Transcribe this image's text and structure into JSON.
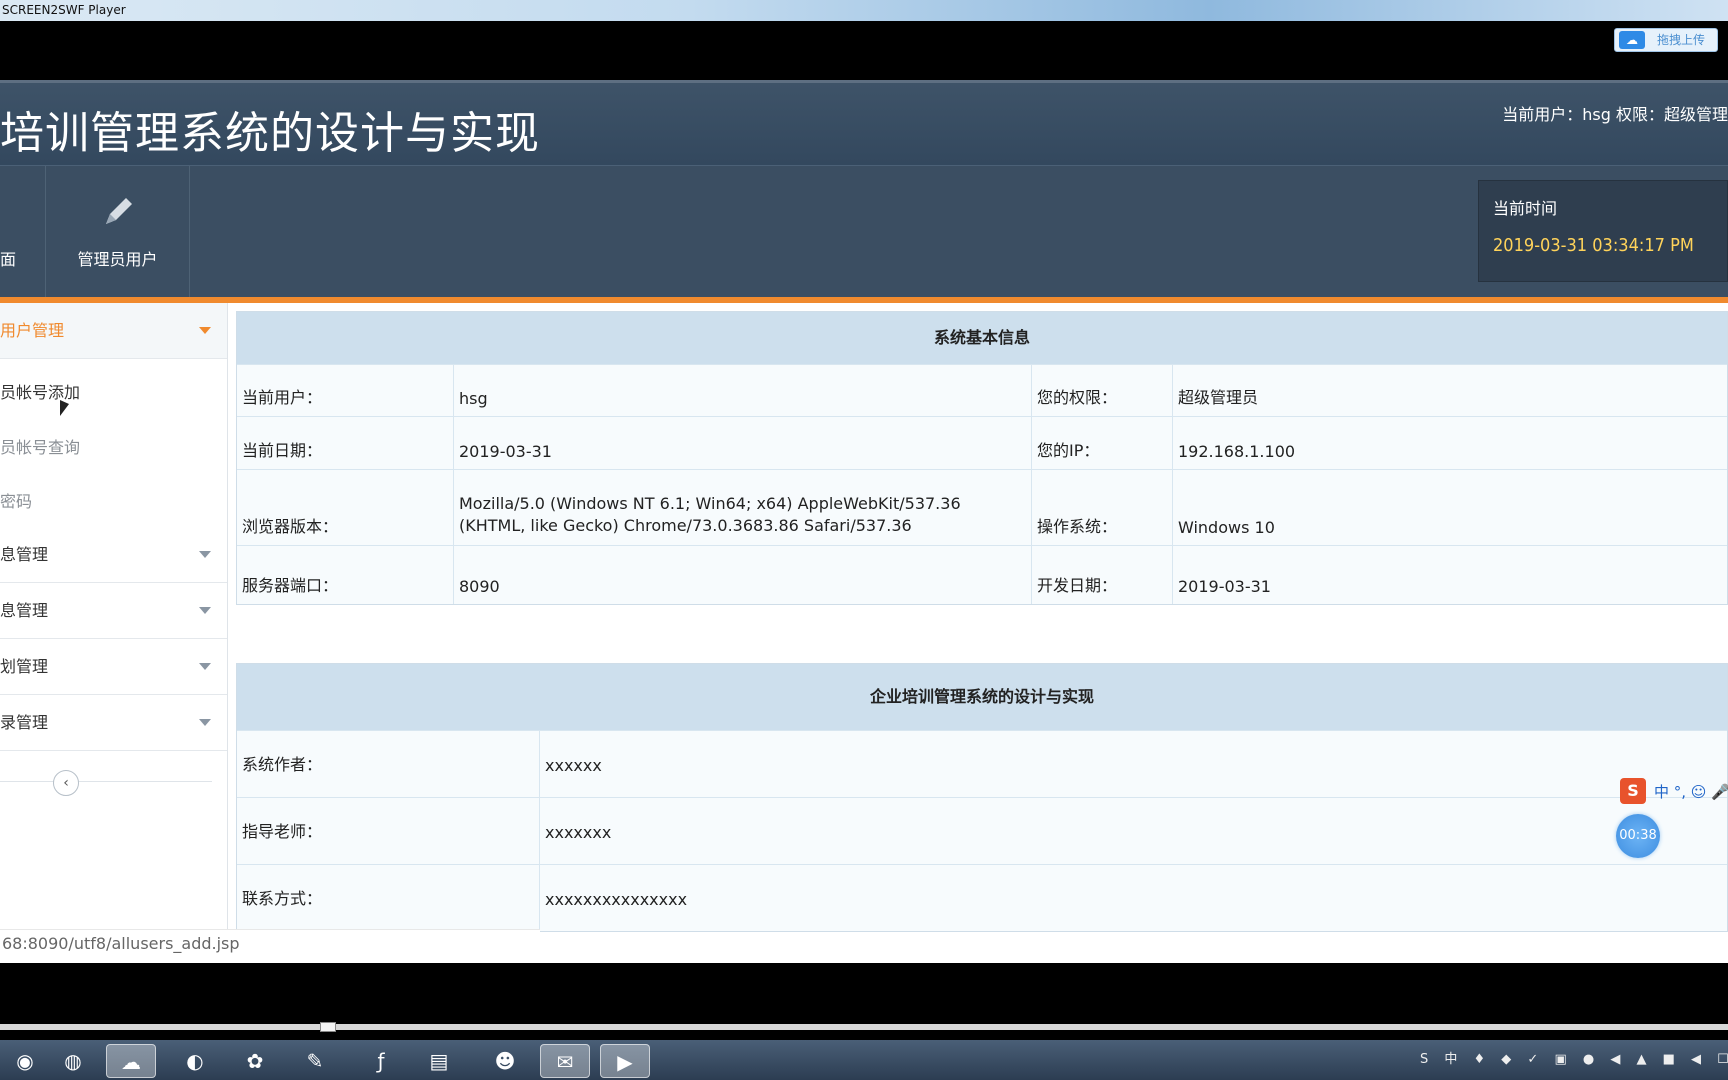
{
  "player": {
    "title": "SCREEN2SWF Player",
    "upload_label": "拖拽上传",
    "upload_icon": "baidu-cloud-icon"
  },
  "header": {
    "title": "培训管理系统的设计与实现",
    "current_user_line": "当前用户：hsg  权限：超级管理"
  },
  "nav": {
    "items": [
      {
        "label": "面",
        "icon": "home-icon"
      },
      {
        "label": "管理员用户",
        "icon": "pencil-icon"
      }
    ],
    "time_label": "当前时间",
    "time_value": "2019-03-31 03:34:17 PM"
  },
  "sidebar": {
    "groups": [
      {
        "label": "用户管理",
        "expanded": true,
        "children": [
          "员帐号添加",
          "员帐号查询",
          "密码"
        ]
      },
      {
        "label": "息管理"
      },
      {
        "label": "息管理"
      },
      {
        "label": "划管理"
      },
      {
        "label": "录管理"
      }
    ],
    "collapse_icon": "chevron-left-icon"
  },
  "system_info": {
    "title": "系统基本信息",
    "rows": [
      {
        "k1": "当前用户：",
        "v1": "hsg",
        "k2": "您的权限：",
        "v2": "超级管理员"
      },
      {
        "k1": "当前日期：",
        "v1": "2019-03-31",
        "k2": "您的IP：",
        "v2": "192.168.1.100"
      },
      {
        "k1": "浏览器版本：",
        "v1": "Mozilla/5.0 (Windows NT 6.1; Win64; x64) AppleWebKit/537.36 (KHTML, like Gecko) Chrome/73.0.3683.86 Safari/537.36",
        "k2": "操作系统：",
        "v2": "Windows 10"
      },
      {
        "k1": "服务器端口：",
        "v1": "8090",
        "k2": "开发日期：",
        "v2": "2019-03-31"
      }
    ]
  },
  "project_info": {
    "title": "企业培训管理系统的设计与实现",
    "rows": [
      {
        "k": "系统作者：",
        "v": "xxxxxx"
      },
      {
        "k": "指导老师：",
        "v": "xxxxxxx"
      },
      {
        "k": "联系方式：",
        "v": "xxxxxxxxxxxxxxx"
      }
    ]
  },
  "status_url": "68:8090/utf8/allusers_add.jsp",
  "ime": {
    "logo": "S",
    "text": "中 °, ☺ 🎤"
  },
  "timer": "00:38",
  "taskbar": {
    "icons": [
      "chrome-icon",
      "eclipse-icon",
      "baidu-cloud-icon",
      "browser-icon",
      "green-app-icon",
      "notepad-icon",
      "flash-icon",
      "folder-icon",
      "qq-icon",
      "wechat-icon",
      "screen-recorder-icon"
    ],
    "tray_text": "S 中 ♦ ◆ ✓ ▣ ● ◀ ▲ ■ ◀ ☐"
  }
}
